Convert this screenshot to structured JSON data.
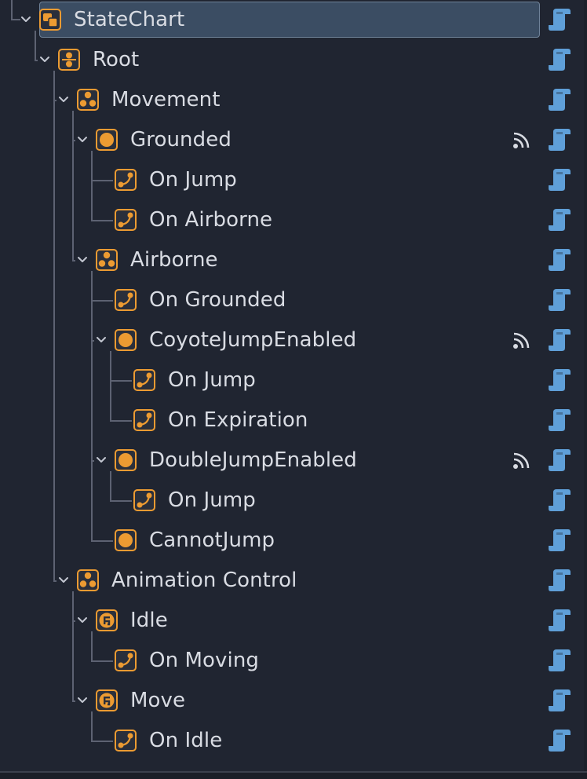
{
  "colors": {
    "background": "#202531",
    "text": "#d9dce3",
    "accent_orange": "#ec9b32",
    "script_blue": "#5f9fd8",
    "selected_bg": "#3b4d63",
    "guide_line": "#5d6272"
  },
  "tree": {
    "nodes": [
      {
        "label": "StateChart",
        "icon": "statechart-icon",
        "depth": 0,
        "expanded": true,
        "selected": true,
        "signal": false,
        "script": true
      },
      {
        "label": "Root",
        "icon": "parallel-state-icon",
        "depth": 1,
        "expanded": true,
        "selected": false,
        "signal": false,
        "script": true
      },
      {
        "label": "Movement",
        "icon": "compound-state-icon",
        "depth": 2,
        "expanded": true,
        "selected": false,
        "signal": false,
        "script": true
      },
      {
        "label": "Grounded",
        "icon": "atomic-state-icon",
        "depth": 3,
        "expanded": true,
        "selected": false,
        "signal": true,
        "script": true
      },
      {
        "label": "On Jump",
        "icon": "transition-icon",
        "depth": 4,
        "expanded": null,
        "selected": false,
        "signal": false,
        "script": true
      },
      {
        "label": "On Airborne",
        "icon": "transition-icon",
        "depth": 4,
        "expanded": null,
        "selected": false,
        "signal": false,
        "script": true
      },
      {
        "label": "Airborne",
        "icon": "compound-state-icon",
        "depth": 3,
        "expanded": true,
        "selected": false,
        "signal": false,
        "script": true
      },
      {
        "label": "On Grounded",
        "icon": "transition-icon",
        "depth": 4,
        "expanded": null,
        "selected": false,
        "signal": false,
        "script": true
      },
      {
        "label": "CoyoteJumpEnabled",
        "icon": "atomic-state-icon",
        "depth": 4,
        "expanded": true,
        "selected": false,
        "signal": true,
        "script": true
      },
      {
        "label": "On Jump",
        "icon": "transition-icon",
        "depth": 5,
        "expanded": null,
        "selected": false,
        "signal": false,
        "script": true
      },
      {
        "label": "On Expiration",
        "icon": "transition-icon",
        "depth": 5,
        "expanded": null,
        "selected": false,
        "signal": false,
        "script": true
      },
      {
        "label": "DoubleJumpEnabled",
        "icon": "atomic-state-icon",
        "depth": 4,
        "expanded": true,
        "selected": false,
        "signal": true,
        "script": true
      },
      {
        "label": "On Jump",
        "icon": "transition-icon",
        "depth": 5,
        "expanded": null,
        "selected": false,
        "signal": false,
        "script": true
      },
      {
        "label": "CannotJump",
        "icon": "atomic-state-icon",
        "depth": 4,
        "expanded": null,
        "selected": false,
        "signal": false,
        "script": true
      },
      {
        "label": "Animation Control",
        "icon": "compound-state-icon",
        "depth": 2,
        "expanded": true,
        "selected": false,
        "signal": false,
        "script": true
      },
      {
        "label": "Idle",
        "icon": "animation-state-icon",
        "depth": 3,
        "expanded": true,
        "selected": false,
        "signal": false,
        "script": true
      },
      {
        "label": "On Moving",
        "icon": "transition-icon",
        "depth": 4,
        "expanded": null,
        "selected": false,
        "signal": false,
        "script": true
      },
      {
        "label": "Move",
        "icon": "animation-state-icon",
        "depth": 3,
        "expanded": true,
        "selected": false,
        "signal": false,
        "script": true
      },
      {
        "label": "On Idle",
        "icon": "transition-icon",
        "depth": 4,
        "expanded": null,
        "selected": false,
        "signal": false,
        "script": true
      }
    ]
  }
}
